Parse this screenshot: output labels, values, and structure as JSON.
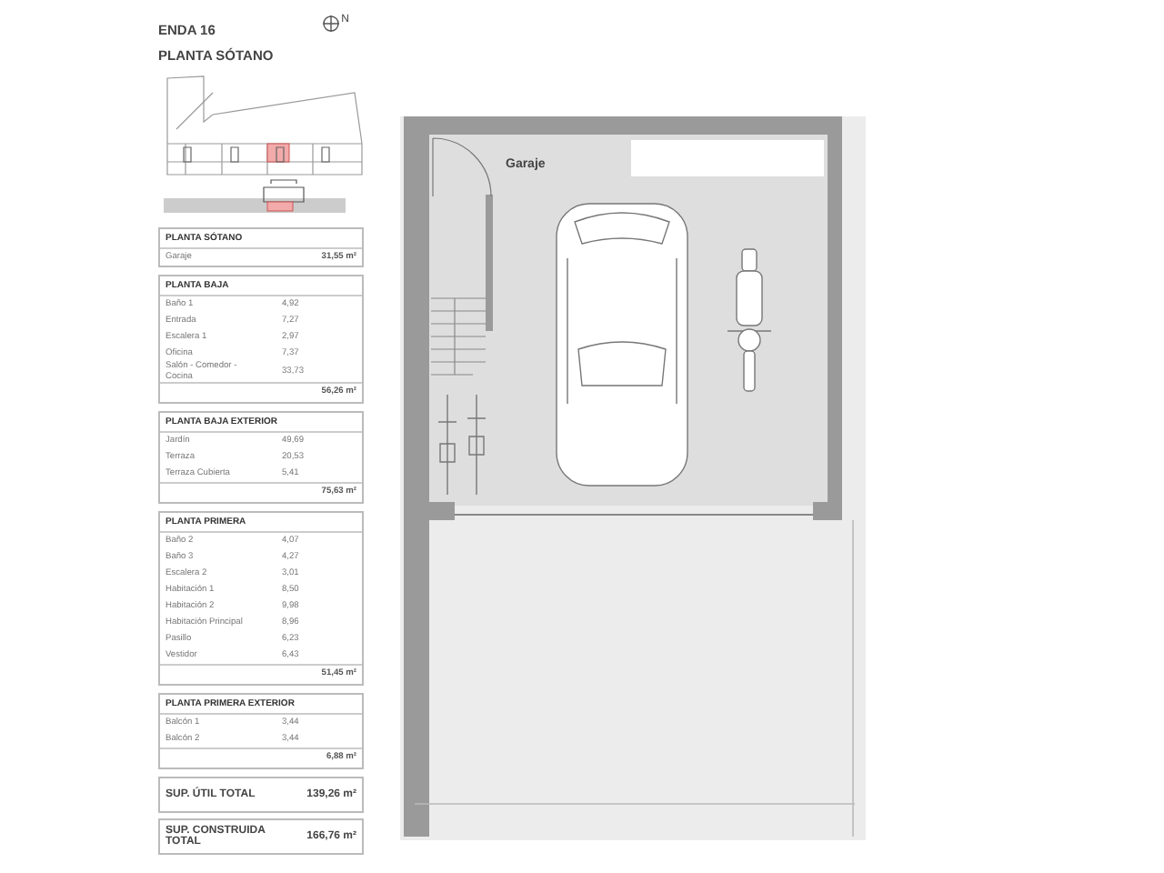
{
  "header": {
    "title": "ENDA 16",
    "subtitle": "PLANTA SÓTANO",
    "compass": "N"
  },
  "tables": [
    {
      "title": "PLANTA SÓTANO",
      "rows": [
        {
          "label": "Garaje",
          "value": "31,55 m²"
        }
      ]
    },
    {
      "title": "PLANTA BAJA",
      "rows": [
        {
          "label": "Baño 1",
          "value": "4,92"
        },
        {
          "label": "Entrada",
          "value": "7,27"
        },
        {
          "label": "Escalera 1",
          "value": "2,97"
        },
        {
          "label": "Oficina",
          "value": "7,37"
        },
        {
          "label": "Salón - Comedor - Cocina",
          "value": "33,73"
        }
      ],
      "total": "56,26 m²"
    },
    {
      "title": "PLANTA BAJA EXTERIOR",
      "rows": [
        {
          "label": "Jardín",
          "value": "49,69"
        },
        {
          "label": "Terraza",
          "value": "20,53"
        },
        {
          "label": "Terraza Cubierta",
          "value": "5,41"
        }
      ],
      "total": "75,63 m²"
    },
    {
      "title": "PLANTA PRIMERA",
      "rows": [
        {
          "label": "Baño 2",
          "value": "4,07"
        },
        {
          "label": "Baño 3",
          "value": "4,27"
        },
        {
          "label": "Escalera 2",
          "value": "3,01"
        },
        {
          "label": "Habitación 1",
          "value": "8,50"
        },
        {
          "label": "Habitación 2",
          "value": "9,98"
        },
        {
          "label": "Habitación Principal",
          "value": "8,96"
        },
        {
          "label": "Pasillo",
          "value": "6,23"
        },
        {
          "label": "Vestidor",
          "value": "6,43"
        }
      ],
      "total": "51,45 m²"
    },
    {
      "title": "PLANTA PRIMERA EXTERIOR",
      "rows": [
        {
          "label": "Balcón 1",
          "value": "3,44"
        },
        {
          "label": "Balcón 2",
          "value": "3,44"
        }
      ],
      "total": "6,88 m²"
    }
  ],
  "summary": [
    {
      "label": "SUP. ÚTIL TOTAL",
      "value": "139,26 m²"
    },
    {
      "label": "SUP. CONSTRUIDA TOTAL",
      "value": "166,76 m²"
    }
  ],
  "plan": {
    "room_label": "Garaje"
  }
}
